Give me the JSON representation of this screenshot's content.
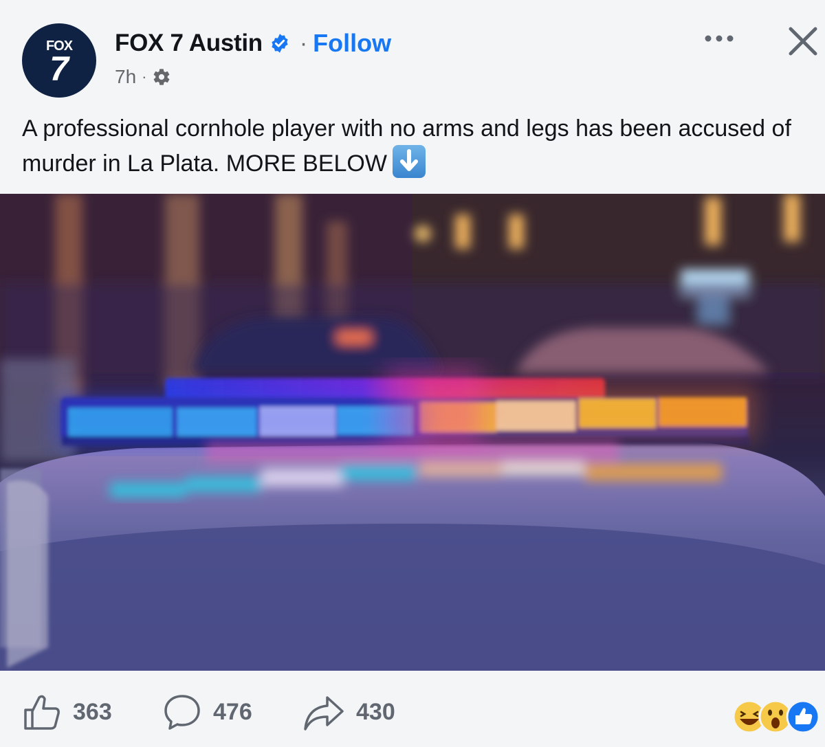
{
  "post": {
    "author": {
      "name": "FOX 7 Austin",
      "avatar_top": "FOX",
      "avatar_number": "7",
      "verified": true
    },
    "follow_label": "Follow",
    "separator": "·",
    "time": "7h",
    "privacy_icon": "gear-icon",
    "text": "A professional cornhole player with no arms and legs has been accused of murder in La Plata. MORE BELOW",
    "text_emoji": "down-arrow-emoji"
  },
  "actions": {
    "likes": "363",
    "comments": "476",
    "shares": "430"
  },
  "reactions": [
    "haha",
    "wow",
    "like"
  ],
  "colors": {
    "accent": "#1877f2",
    "text": "#111418",
    "muted": "#65676b",
    "avatar_bg": "#0f2244",
    "background": "#f4f5f6"
  }
}
